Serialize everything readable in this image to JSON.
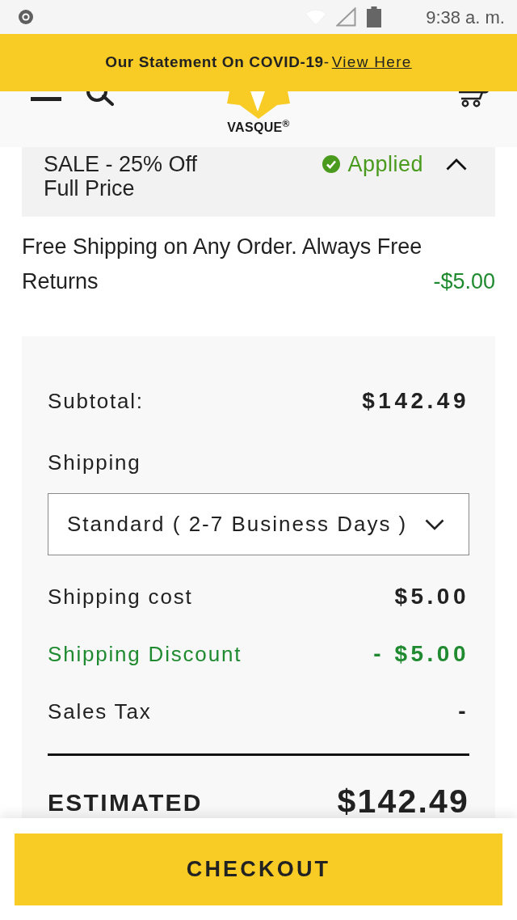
{
  "status_bar": {
    "time": "9:38 a. m."
  },
  "banner": {
    "message": "**Our Statement On COVID-19**-",
    "link": "View Here"
  },
  "header": {
    "logo": "VASQUE$^{®}$"
  },
  "promo": {
    "title": "SALE - 25% Off Full Price",
    "status": "Applied",
    "expanded": true
  },
  "shipping_note": {
    "text": "Free Shipping on Any Order. Always Free Returns",
    "amount": "-$5.00"
  },
  "summary": {
    "rows": [
      {
        "kind": "amount",
        "label": "Subtotal:",
        "value": "$142.49"
      },
      {
        "kind": "select",
        "label": "Shipping",
        "value": "Standard ( 2-7 Business Days )"
      },
      {
        "kind": "amount",
        "label": "Shipping cost",
        "value": "$5.00"
      },
      {
        "kind": "discount",
        "label": "Shipping Discount",
        "value": "- $5.00"
      },
      {
        "kind": "amount",
        "label": "Sales Tax",
        "value": "-"
      }
    ],
    "total": {
      "label": "ESTIMATED",
      "value": "$142.49"
    }
  },
  "checkout_button": "CHECKOUT"
}
